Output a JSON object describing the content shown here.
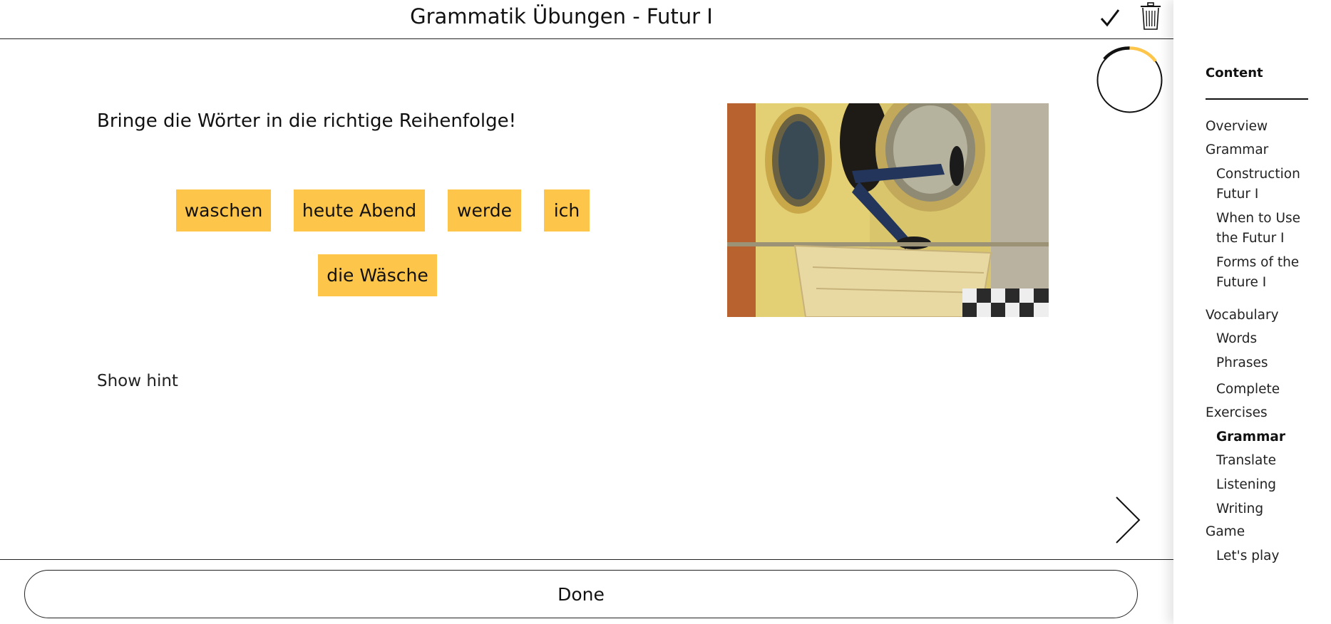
{
  "header": {
    "title": "Grammatik Übungen - Futur I",
    "check_icon": "checkmark-icon",
    "trash_icon": "trash-icon"
  },
  "progress": {
    "value": 0.15,
    "color": "#fec54b"
  },
  "exercise": {
    "instruction": "Bringe die Wörter in die richtige Reihenfolge!",
    "words": [
      "waschen",
      "heute Abend",
      "werde",
      "ich",
      "die Wäsche"
    ],
    "hint_label": "Show hint",
    "chip_color": "#fec54b"
  },
  "navigation": {
    "next_icon": "chevron-right-icon"
  },
  "footer": {
    "done_label": "Done"
  },
  "sidebar": {
    "heading": "Content",
    "items": [
      {
        "label": "Overview",
        "level": 0
      },
      {
        "label": "Grammar",
        "level": 0
      },
      {
        "label": "Construction Futur I",
        "level": 1
      },
      {
        "label": "When to Use the Futur I",
        "level": 1
      },
      {
        "label": "Forms of the Future I",
        "level": 1
      },
      {
        "label": "Vocabulary",
        "level": 0
      },
      {
        "label": "Words",
        "level": 1
      },
      {
        "label": "Phrases",
        "level": 1
      },
      {
        "label": "Complete",
        "level": 1
      },
      {
        "label": "Exercises",
        "level": 0
      },
      {
        "label": "Grammar",
        "level": 1,
        "active": true
      },
      {
        "label": "Translate",
        "level": 1
      },
      {
        "label": "Listening",
        "level": 1
      },
      {
        "label": "Writing",
        "level": 1
      },
      {
        "label": "Game",
        "level": 0
      },
      {
        "label": "Let's play",
        "level": 1
      }
    ]
  }
}
